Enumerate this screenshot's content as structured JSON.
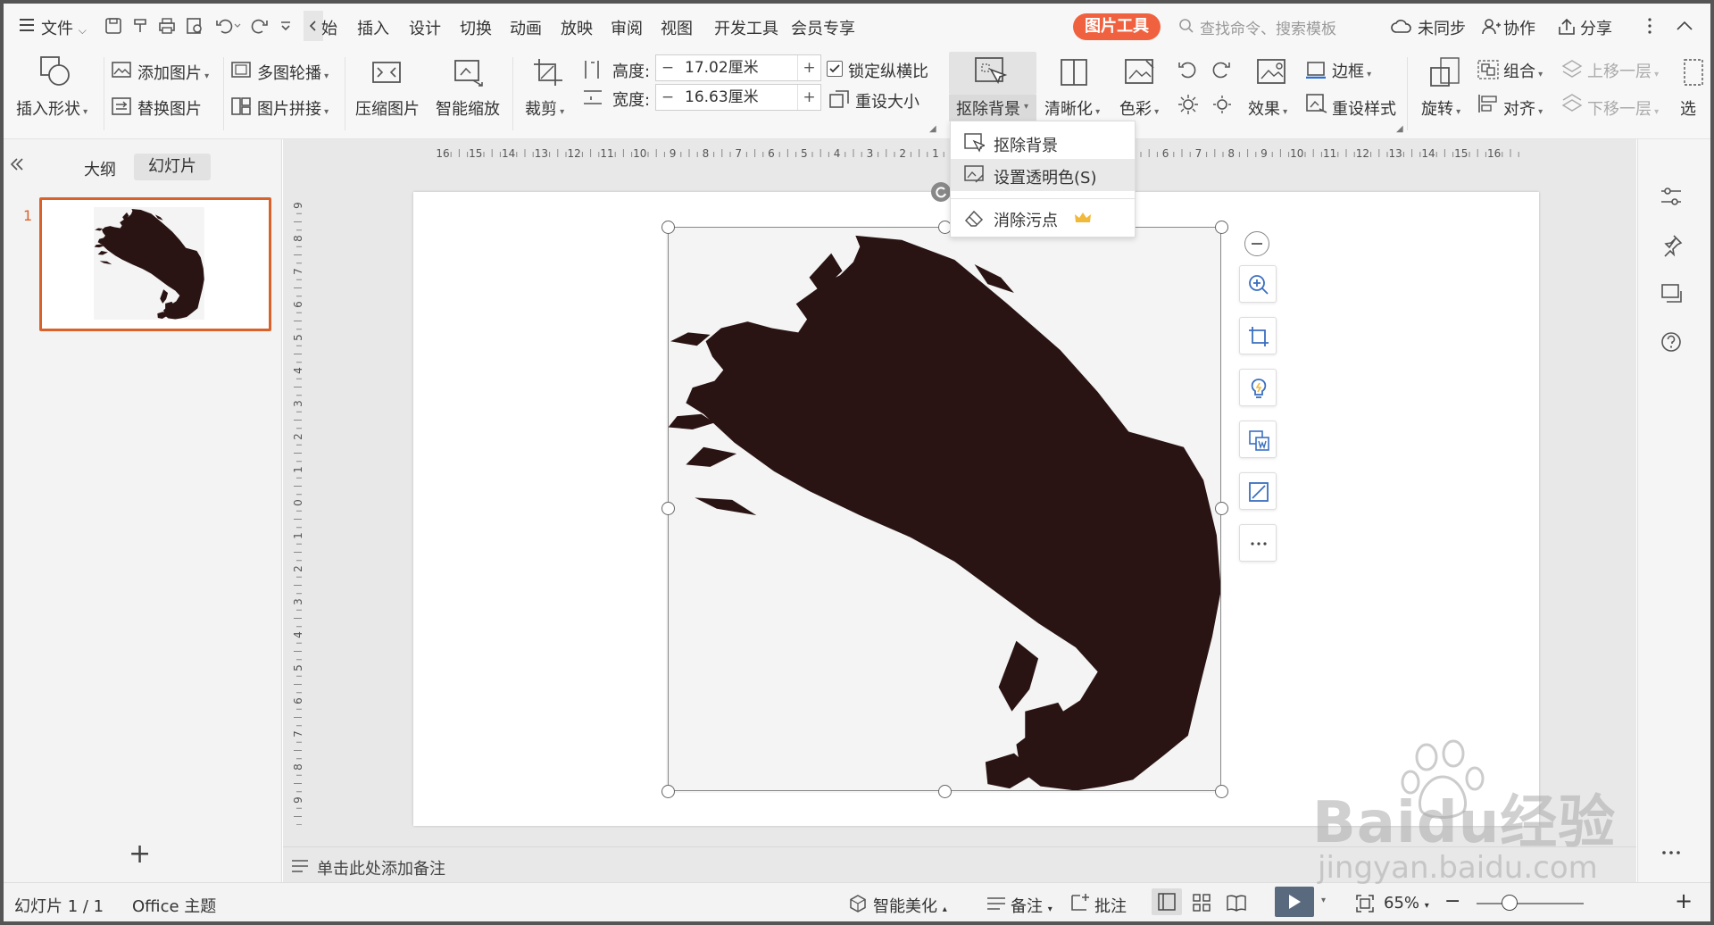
{
  "menu": {
    "file": "文件",
    "tabs": [
      "始",
      "插入",
      "设计",
      "切换",
      "动画",
      "放映",
      "审阅",
      "视图",
      "开发工具",
      "会员专享"
    ],
    "active_tab": "图片工具",
    "search_placeholder": "查找命令、搜索模板",
    "sync": "未同步",
    "collab": "协作",
    "share": "分享"
  },
  "ribbon": {
    "insert_shape": "插入形状",
    "add_picture": "添加图片",
    "replace_picture": "替换图片",
    "multi_carousel": "多图轮播",
    "picture_collage": "图片拼接",
    "compress": "压缩图片",
    "smart_zoom": "智能缩放",
    "crop": "裁剪",
    "height_label": "高度:",
    "height_value": "17.02厘米",
    "width_label": "宽度:",
    "width_value": "16.63厘米",
    "lock_ratio": "锁定纵横比",
    "reset_size": "重设大小",
    "remove_bg": "抠除背景",
    "sharpen": "清晰化",
    "color": "色彩",
    "effects": "效果",
    "border": "边框",
    "reset_style": "重设样式",
    "rotate": "旋转",
    "group": "组合",
    "align": "对齐",
    "bring_forward": "上移一层",
    "send_backward": "下移一层",
    "select": "选",
    "minus": "−",
    "plus": "+"
  },
  "dropdown": {
    "items": [
      "抠除背景",
      "设置透明色(S)",
      "消除污点"
    ]
  },
  "left": {
    "outline_tab": "大纲",
    "slides_tab": "幻灯片",
    "slide_number": "1",
    "add": "+"
  },
  "ruler": {
    "h": [
      "16",
      "15",
      "14",
      "13",
      "12",
      "11",
      "10",
      "9",
      "8",
      "7",
      "6",
      "5",
      "4",
      "3",
      "2",
      "1",
      "0",
      "1",
      "2",
      "3",
      "4",
      "5",
      "6",
      "7",
      "8",
      "9",
      "10",
      "11",
      "12",
      "13",
      "14",
      "15",
      "16"
    ],
    "v": [
      "9",
      "8",
      "7",
      "6",
      "5",
      "4",
      "3",
      "2",
      "1",
      "0",
      "1",
      "2",
      "3",
      "4",
      "5",
      "6",
      "7",
      "8",
      "9"
    ]
  },
  "notes_placeholder": "单击此处添加备注",
  "status": {
    "slide_count": "幻灯片 1 / 1",
    "theme": "Office 主题",
    "smart_beautify": "智能美化",
    "notes": "备注",
    "comments": "批注",
    "zoom": "65%",
    "zoom_level": 0.65,
    "minus": "−",
    "plus": "+"
  },
  "watermark": {
    "brand": "Baidu经验",
    "url": "jingyan.baidu.com"
  },
  "colors": {
    "accent": "#f0623f",
    "thumb_border": "#d9622b",
    "ink": "#2a1413",
    "play_button": "#5a6a7e"
  }
}
